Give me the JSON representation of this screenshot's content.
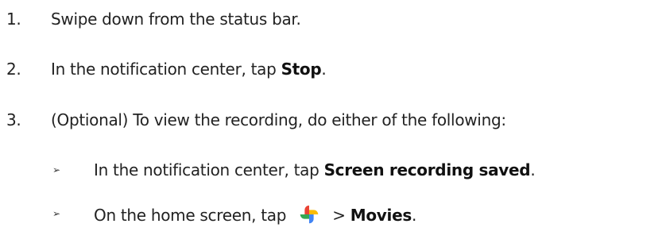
{
  "steps": [
    {
      "number": "1.",
      "text": "Swipe down from the status bar."
    },
    {
      "number": "2.",
      "text_before": "In the notification center, tap ",
      "bold": "Stop",
      "text_after": "."
    },
    {
      "number": "3.",
      "text": "(Optional) To view the recording, do either of the following:"
    }
  ],
  "substeps": [
    {
      "bullet": "➢",
      "text_before": "In the notification center, tap ",
      "bold": "Screen recording saved",
      "text_after": "."
    },
    {
      "bullet": "➢",
      "text_before": "On the home screen, tap ",
      "icon": "google-photos-pinwheel-icon",
      "separator": " > ",
      "bold": "Movies",
      "text_after": "."
    }
  ],
  "colors": {
    "text": "#222222",
    "photos_red": "#EA4335",
    "photos_yellow": "#FBBC04",
    "photos_green": "#34A853",
    "photos_blue": "#4285F4"
  }
}
